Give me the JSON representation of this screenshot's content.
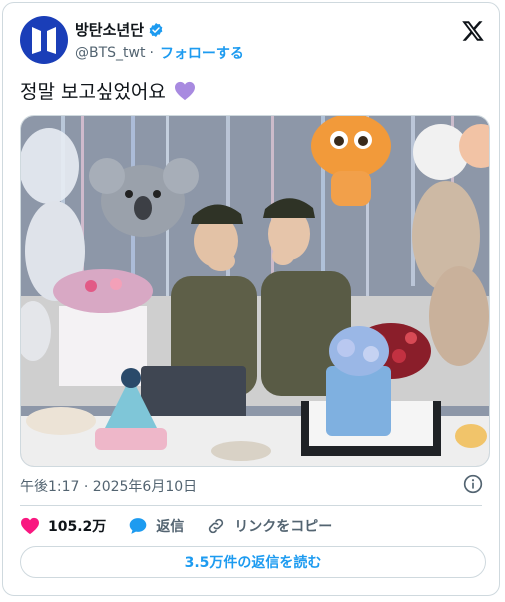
{
  "author": {
    "display_name": "방탄소년단",
    "handle": "@BTS_twt",
    "separator": "·",
    "follow_label": "フォローする",
    "verified": true
  },
  "tweet": {
    "text": "정말 보고싶었어요",
    "emoji": "purple-heart"
  },
  "meta": {
    "timestamp": "午後1:17 · 2025年6月10日"
  },
  "actions": {
    "likes_count": "105.2万",
    "reply_label": "返信",
    "copy_link_label": "リンクをコピー"
  },
  "read_replies_label": "3.5万件の返信を読む",
  "colors": {
    "accent": "#1d9bf0",
    "like": "#f91880",
    "avatar_bg": "#1a3eb8",
    "emoji_purple": "#a88ae0"
  }
}
